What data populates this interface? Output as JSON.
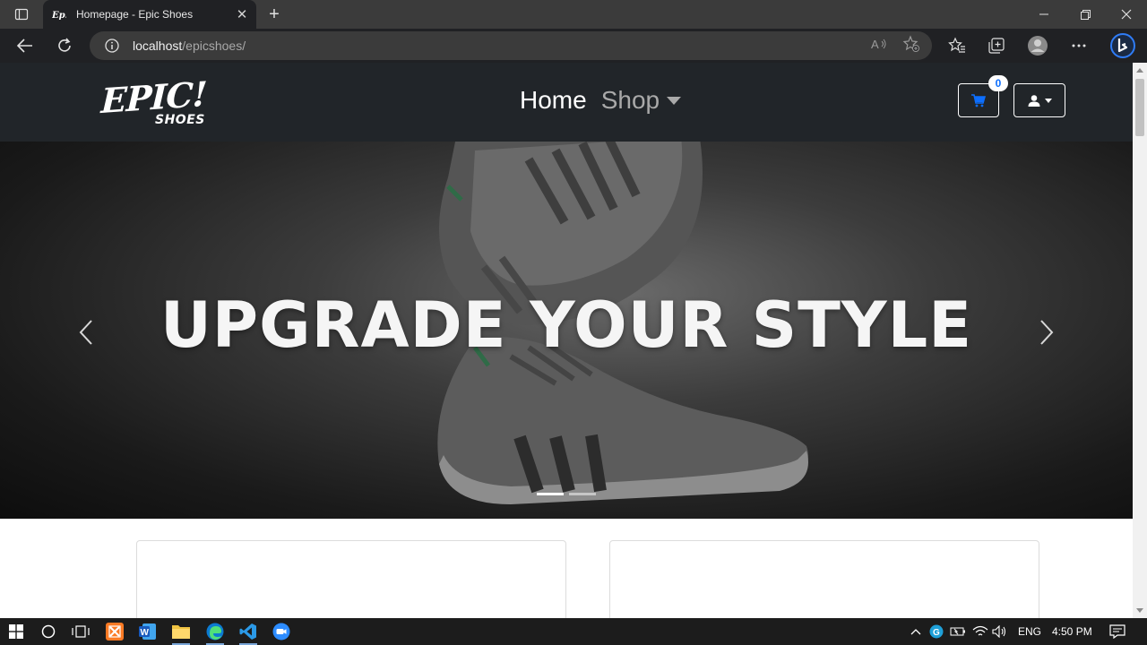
{
  "browser": {
    "tab_title": "Homepage - Epic Shoes",
    "tab_close": "✕",
    "new_tab": "+",
    "url_host": "localhost",
    "url_path": "/epicshoes/"
  },
  "site": {
    "logo_main": "EPIC!",
    "logo_sub": "SHOES",
    "nav": {
      "home_label": "Home",
      "shop_label": "Shop"
    },
    "cart_count": "0"
  },
  "hero": {
    "title": "UPGRADE YOUR STYLE",
    "slide_count": 2,
    "active_slide": 1
  },
  "taskbar": {
    "language": "ENG",
    "time": "4:50 PM"
  },
  "colors": {
    "navbar_bg": "#212529",
    "accent_blue": "#0d6efd",
    "hero_bg": "#1a1a1a"
  }
}
